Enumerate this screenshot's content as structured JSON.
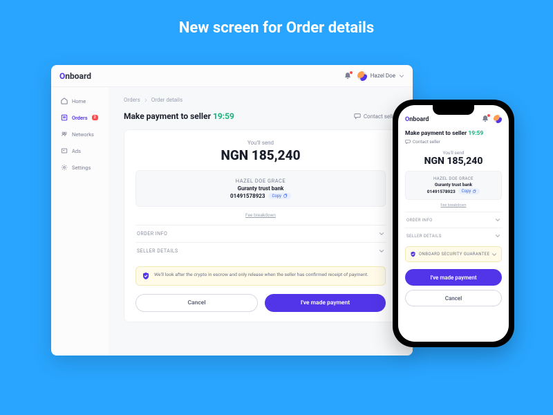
{
  "hero": {
    "title": "New screen for Order details"
  },
  "brand": {
    "o": "O",
    "rest": "nboard"
  },
  "header": {
    "user_name": "Hazel Doe"
  },
  "sidebar": {
    "items": [
      {
        "label": "Home",
        "icon": "home-icon"
      },
      {
        "label": "Orders",
        "icon": "orders-icon",
        "badge": "2",
        "active": true
      },
      {
        "label": "Networks",
        "icon": "networks-icon"
      },
      {
        "label": "Ads",
        "icon": "ads-icon"
      },
      {
        "label": "Settings",
        "icon": "settings-icon"
      }
    ]
  },
  "breadcrumb": {
    "root": "Orders",
    "current": "Order details"
  },
  "order": {
    "title": "Make payment to seller",
    "timer": "19:59",
    "contact": "Contact seller",
    "lede": "You'll send",
    "amount": "NGN 185,240",
    "account": {
      "name": "HAZEL DOE GRACE",
      "bank": "Guranty trust bank",
      "number": "01491578923",
      "copy": "Copy"
    },
    "fee_link": "Fee breakdown",
    "accordion": {
      "info": "ORDER INFO",
      "seller": "SELLER DETAILS",
      "security": "ONBOARD SECURITY GUARANTEE"
    },
    "notice": "We'll look after the crypto in escrow and only release when the seller has confirmed receipt of payment.",
    "actions": {
      "cancel": "Cancel",
      "paid": "I've made payment"
    }
  }
}
